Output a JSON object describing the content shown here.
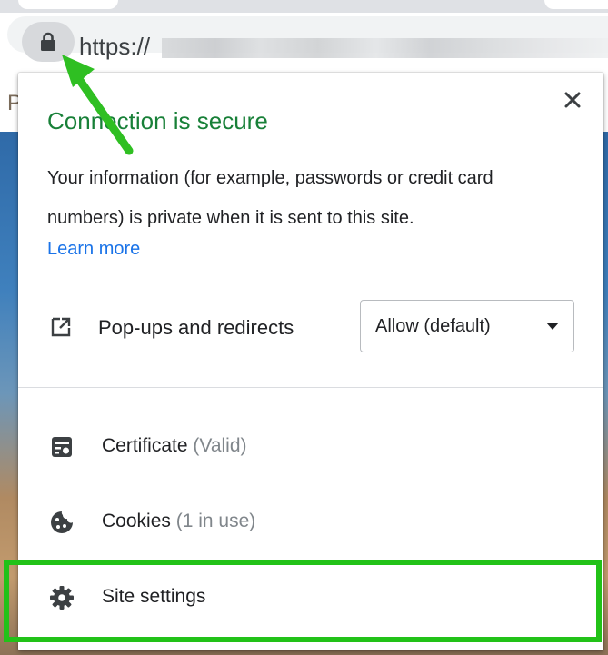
{
  "browser": {
    "url_prefix": "https://"
  },
  "page": {
    "partial_letter": "P"
  },
  "popup": {
    "title": "Connection is secure",
    "description": "Your information (for example, passwords or credit card numbers) is private when it is sent to this site.",
    "learn_more": "Learn more",
    "close_symbol": "✕",
    "permission": {
      "label": "Pop-ups and redirects",
      "selected": "Allow (default)",
      "icon": "external-link-icon"
    },
    "items": [
      {
        "label": "Certificate",
        "sub": "(Valid)",
        "icon": "certificate-icon"
      },
      {
        "label": "Cookies",
        "sub": "(1 in use)",
        "icon": "cookie-icon"
      },
      {
        "label": "Site settings",
        "icon": "gear-icon"
      }
    ]
  },
  "colors": {
    "secure_green": "#188038",
    "link_blue": "#1a73e8",
    "annotation_green": "#22c218"
  }
}
